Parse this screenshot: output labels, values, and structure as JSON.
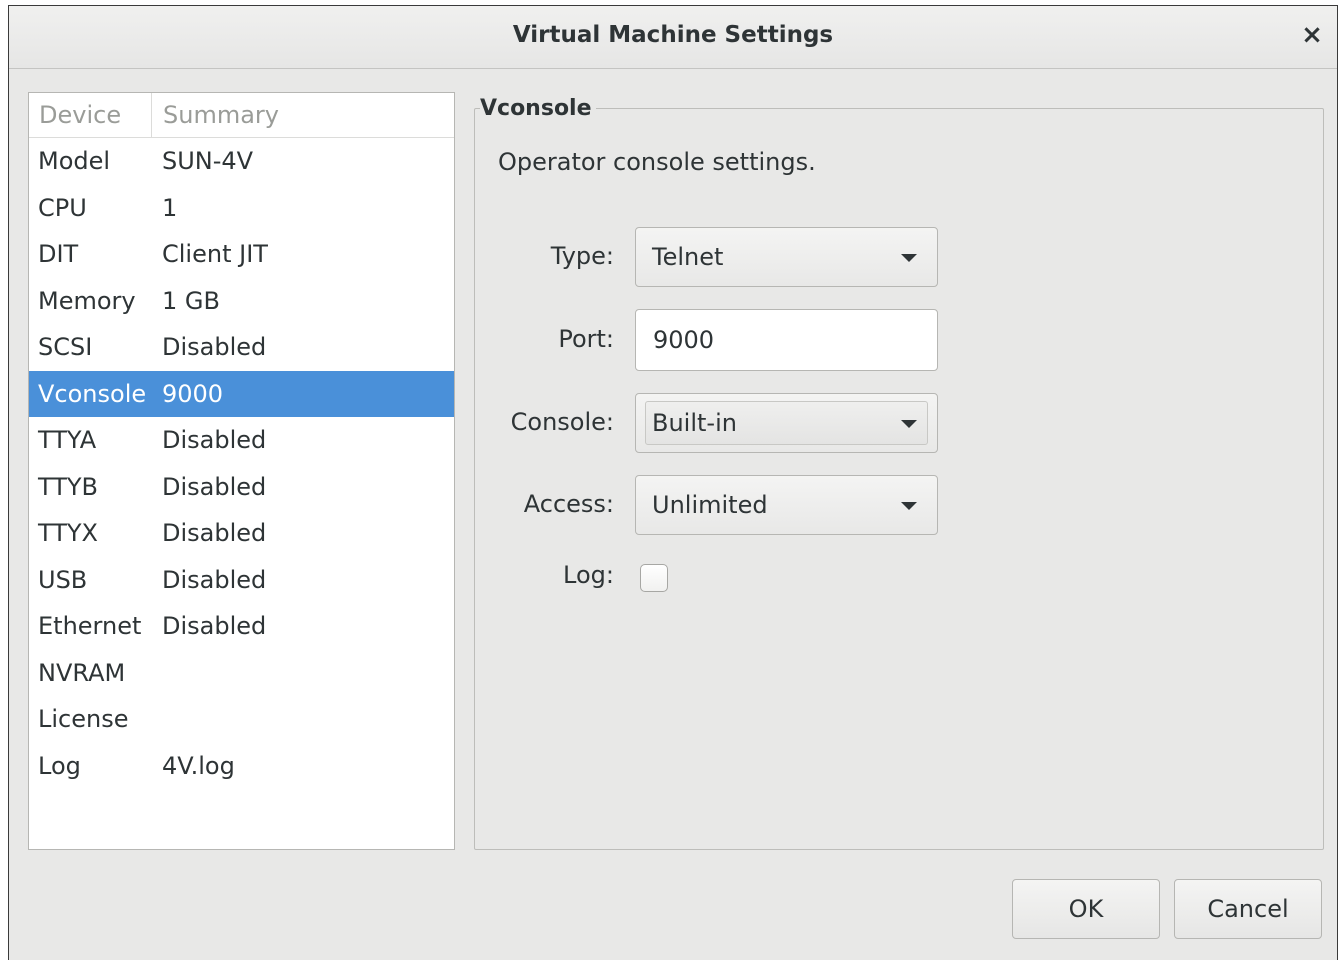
{
  "window": {
    "title": "Virtual Machine Settings",
    "close_glyph": "×"
  },
  "devices": {
    "headers": {
      "device": "Device",
      "summary": "Summary"
    },
    "rows": [
      {
        "device": "Model",
        "summary": "SUN-4V"
      },
      {
        "device": "CPU",
        "summary": "1"
      },
      {
        "device": "DIT",
        "summary": "Client JIT"
      },
      {
        "device": "Memory",
        "summary": "1 GB"
      },
      {
        "device": "SCSI",
        "summary": "Disabled"
      },
      {
        "device": "Vconsole",
        "summary": "9000",
        "selected": true
      },
      {
        "device": "TTYA",
        "summary": "Disabled"
      },
      {
        "device": "TTYB",
        "summary": "Disabled"
      },
      {
        "device": "TTYX",
        "summary": "Disabled"
      },
      {
        "device": "USB",
        "summary": "Disabled"
      },
      {
        "device": "Ethernet",
        "summary": "Disabled"
      },
      {
        "device": "NVRAM",
        "summary": ""
      },
      {
        "device": "License",
        "summary": ""
      },
      {
        "device": "Log",
        "summary": "4V.log"
      }
    ]
  },
  "panel": {
    "title": "Vconsole",
    "description": "Operator console settings.",
    "type": {
      "label": "Type:",
      "value": "Telnet"
    },
    "port": {
      "label": "Port:",
      "value": "9000"
    },
    "console": {
      "label": "Console:",
      "value": "Built-in"
    },
    "access": {
      "label": "Access:",
      "value": "Unlimited"
    },
    "log": {
      "label": "Log:",
      "checked": false
    }
  },
  "buttons": {
    "ok": "OK",
    "cancel": "Cancel"
  },
  "colors": {
    "selection": "#4a90d9",
    "window_bg": "#e8e8e7"
  },
  "icons": {
    "dropdown": "triangle-down-icon",
    "close": "close-icon"
  }
}
